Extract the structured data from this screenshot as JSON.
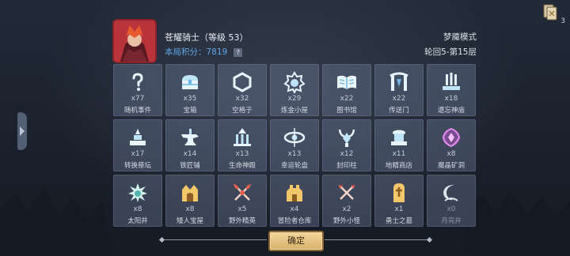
{
  "hero": {
    "name": "苍耀骑士（等级 53）",
    "score_text": "本局积分：7819",
    "help_label": "?"
  },
  "mode": "梦魇模式",
  "stage": "轮回5-第15层",
  "corner": {
    "count": "3"
  },
  "colors": {
    "accent_blue": "#5ea7e8",
    "button_gold": "#e3bd7a"
  },
  "cells": [
    {
      "icon": "question-icon",
      "count": "x77",
      "label": "随机事件"
    },
    {
      "icon": "treasure-chest-icon",
      "count": "x35",
      "label": "宝箱"
    },
    {
      "icon": "hexagon-icon",
      "count": "x32",
      "label": "空格子"
    },
    {
      "icon": "alchemy-icon",
      "count": "x29",
      "label": "炼金小屋"
    },
    {
      "icon": "book-icon",
      "count": "x22",
      "label": "图书馆"
    },
    {
      "icon": "portal-icon",
      "count": "x22",
      "label": "传送门"
    },
    {
      "icon": "temple-icon",
      "count": "x18",
      "label": "遗忘神庙"
    },
    {
      "icon": "altar-icon",
      "count": "x17",
      "label": "转换祭坛"
    },
    {
      "icon": "anvil-icon",
      "count": "x14",
      "label": "铁匠铺"
    },
    {
      "icon": "shrine-icon",
      "count": "x13",
      "label": "生命神殿"
    },
    {
      "icon": "wheel-icon",
      "count": "x13",
      "label": "幸运轮盘"
    },
    {
      "icon": "seal-pillar-icon",
      "count": "x12",
      "label": "封印柱"
    },
    {
      "icon": "shop-icon",
      "count": "x11",
      "label": "地精商店"
    },
    {
      "icon": "crystal-mine-icon",
      "count": "x8",
      "label": "魔晶矿洞"
    },
    {
      "icon": "sun-well-icon",
      "count": "x8",
      "label": "太阳井"
    },
    {
      "icon": "dwarf-vault-icon",
      "count": "x8",
      "label": "矮人宝屋"
    },
    {
      "icon": "elite-axe-icon",
      "count": "x5",
      "label": "野外精英"
    },
    {
      "icon": "storehouse-icon",
      "count": "x4",
      "label": "冒险者仓库"
    },
    {
      "icon": "swords-icon",
      "count": "x2",
      "label": "野外小怪"
    },
    {
      "icon": "tomb-icon",
      "count": "x1",
      "label": "勇士之墓"
    },
    {
      "icon": "moon-well-icon",
      "count": "x0",
      "label": "月亮井"
    }
  ],
  "confirm_label": "确定"
}
